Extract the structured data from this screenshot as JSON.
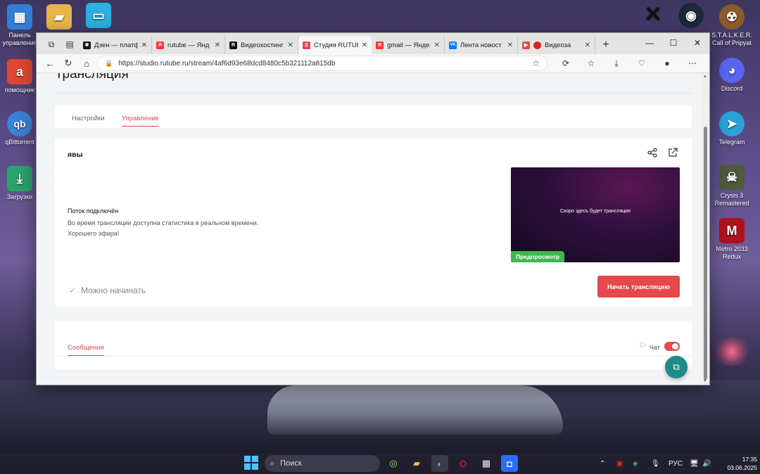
{
  "desktop": {
    "left_icons": [
      {
        "label": "Панель управления",
        "color": "#2f7fd6",
        "glyph": "▦"
      },
      {
        "label": "",
        "color": "#e8b54a",
        "glyph": "▰"
      },
      {
        "label": "",
        "color": "#2ab0e0",
        "glyph": "▭"
      },
      {
        "label": "помощник",
        "color": "#e0462f",
        "glyph": "a"
      },
      {
        "label": "qBittorrent",
        "color": "#3a82d8",
        "glyph": "qb"
      },
      {
        "label": "Загрузки",
        "color": "#2aa36b",
        "glyph": "⤓"
      }
    ],
    "right_icons": [
      {
        "label": "",
        "color": "#222",
        "glyph": "✕"
      },
      {
        "label": "",
        "color": "#1b2838",
        "glyph": "◉"
      },
      {
        "label": "S.T.A.L.K.E.R. Call of Pripyat",
        "color": "#8a5a2a",
        "glyph": "☢"
      },
      {
        "label": "Discord",
        "color": "#5865f2",
        "glyph": "◕"
      },
      {
        "label": "Telegram",
        "color": "#2aa1da",
        "glyph": "➤"
      },
      {
        "label": "Crysis 3 Remastered",
        "color": "#4e5a3a",
        "glyph": "☠"
      },
      {
        "label": "Metro 2033 Redux",
        "color": "#b0121b",
        "glyph": "M"
      }
    ]
  },
  "browser": {
    "tabs": [
      {
        "title": "Дзен — платф",
        "fav_color": "#111",
        "fav": "✱",
        "active": false
      },
      {
        "title": "rutube — Янд",
        "fav_color": "#f33",
        "fav": "Я",
        "active": false
      },
      {
        "title": "Видеохостинг",
        "fav_color": "#111",
        "fav": "R",
        "active": false
      },
      {
        "title": "Студия RUTUBE",
        "fav_color": "#e5484d",
        "fav": "S",
        "active": true
      },
      {
        "title": "gmail — Янде",
        "fav_color": "#f33",
        "fav": "Я",
        "active": false
      },
      {
        "title": "Лента новост",
        "fav_color": "#0077ff",
        "fav": "VK",
        "active": false
      },
      {
        "title": "Видеоза",
        "fav_color": "#e02020",
        "fav": "●",
        "active": false
      }
    ],
    "url": "https://studio.rutube.ru/stream/4af6d93e68dcd8480c5b321112a815db"
  },
  "page": {
    "title": "Трансляция",
    "tabs": {
      "settings": "Настройки",
      "control": "Управление"
    },
    "stream_name": "явы",
    "status_title": "Поток подключён",
    "status_line1": "Во время трансляции доступна статистика в реальном времени.",
    "status_line2": "Хорошего эфира!",
    "preview_soon": "Скоро здесь будет трансляция",
    "preview_badge": "Предпросмотр",
    "ready_text": "Можно начинать",
    "start_button": "Начать трансляцию",
    "messages_tab": "Сообщения",
    "chat_label": "Чат"
  },
  "taskbar": {
    "search_placeholder": "Поиск",
    "lang": "РУС",
    "time": "17:35",
    "date": "03.06.2025"
  }
}
